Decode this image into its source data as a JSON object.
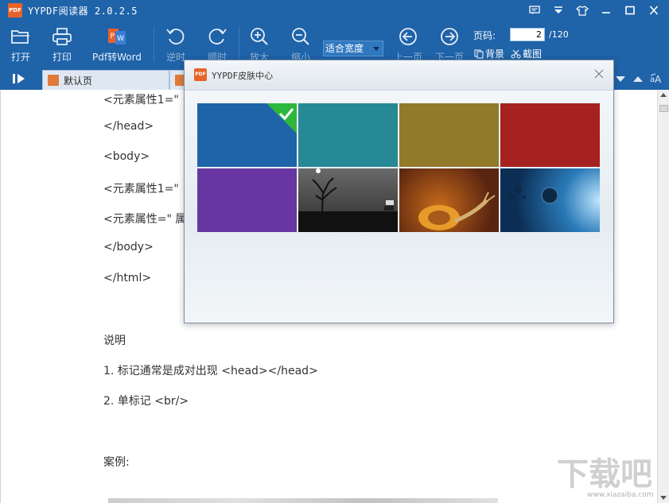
{
  "titlebar": {
    "logo_text": "PDF",
    "title": "YYPDF阅读器 2.0.2.5"
  },
  "toolbar": {
    "open": "打开",
    "print": "打印",
    "pdf2word": "Pdf转Word",
    "rotate_ccw": "逆时",
    "rotate_cw": "顺时",
    "zoom_in": "放大",
    "zoom_out": "缩小",
    "zoom_mode": "适合宽度",
    "prev_page": "上一页",
    "next_page": "下一页",
    "page_label": "页码:",
    "page_value": "2",
    "page_total": "/120",
    "background": "背景",
    "screenshot": "截图"
  },
  "tabs": [
    {
      "label": "默认页"
    }
  ],
  "document": {
    "lines": [
      "<元素属性1=\"",
      "</head>",
      "<body>",
      "<元素属性1=\"",
      "<元素属性=\" 属",
      "</body>",
      "</html>",
      "说明",
      "1. 标记通常是成对出现 <head></head>",
      "2. 单标记 <br/>",
      "案例:"
    ]
  },
  "dialog": {
    "logo_text": "PDF",
    "title": "YYPDF皮肤中心",
    "skins": [
      {
        "name": "blue",
        "color": "#1f63a9",
        "selected": true
      },
      {
        "name": "teal",
        "color": "#278995",
        "selected": false
      },
      {
        "name": "olive",
        "color": "#917a2a",
        "selected": false
      },
      {
        "name": "red",
        "color": "#a62221",
        "selected": false
      },
      {
        "name": "purple",
        "color": "#6736a1",
        "selected": false
      },
      {
        "name": "dark-tree",
        "color": "#3a3a3a",
        "selected": false
      },
      {
        "name": "snail",
        "color": "#b85a1a",
        "selected": false
      },
      {
        "name": "space",
        "color": "#1a5a8a",
        "selected": false
      }
    ]
  },
  "watermark": {
    "text": "下载吧",
    "url": "www.xiazaiba.com"
  }
}
